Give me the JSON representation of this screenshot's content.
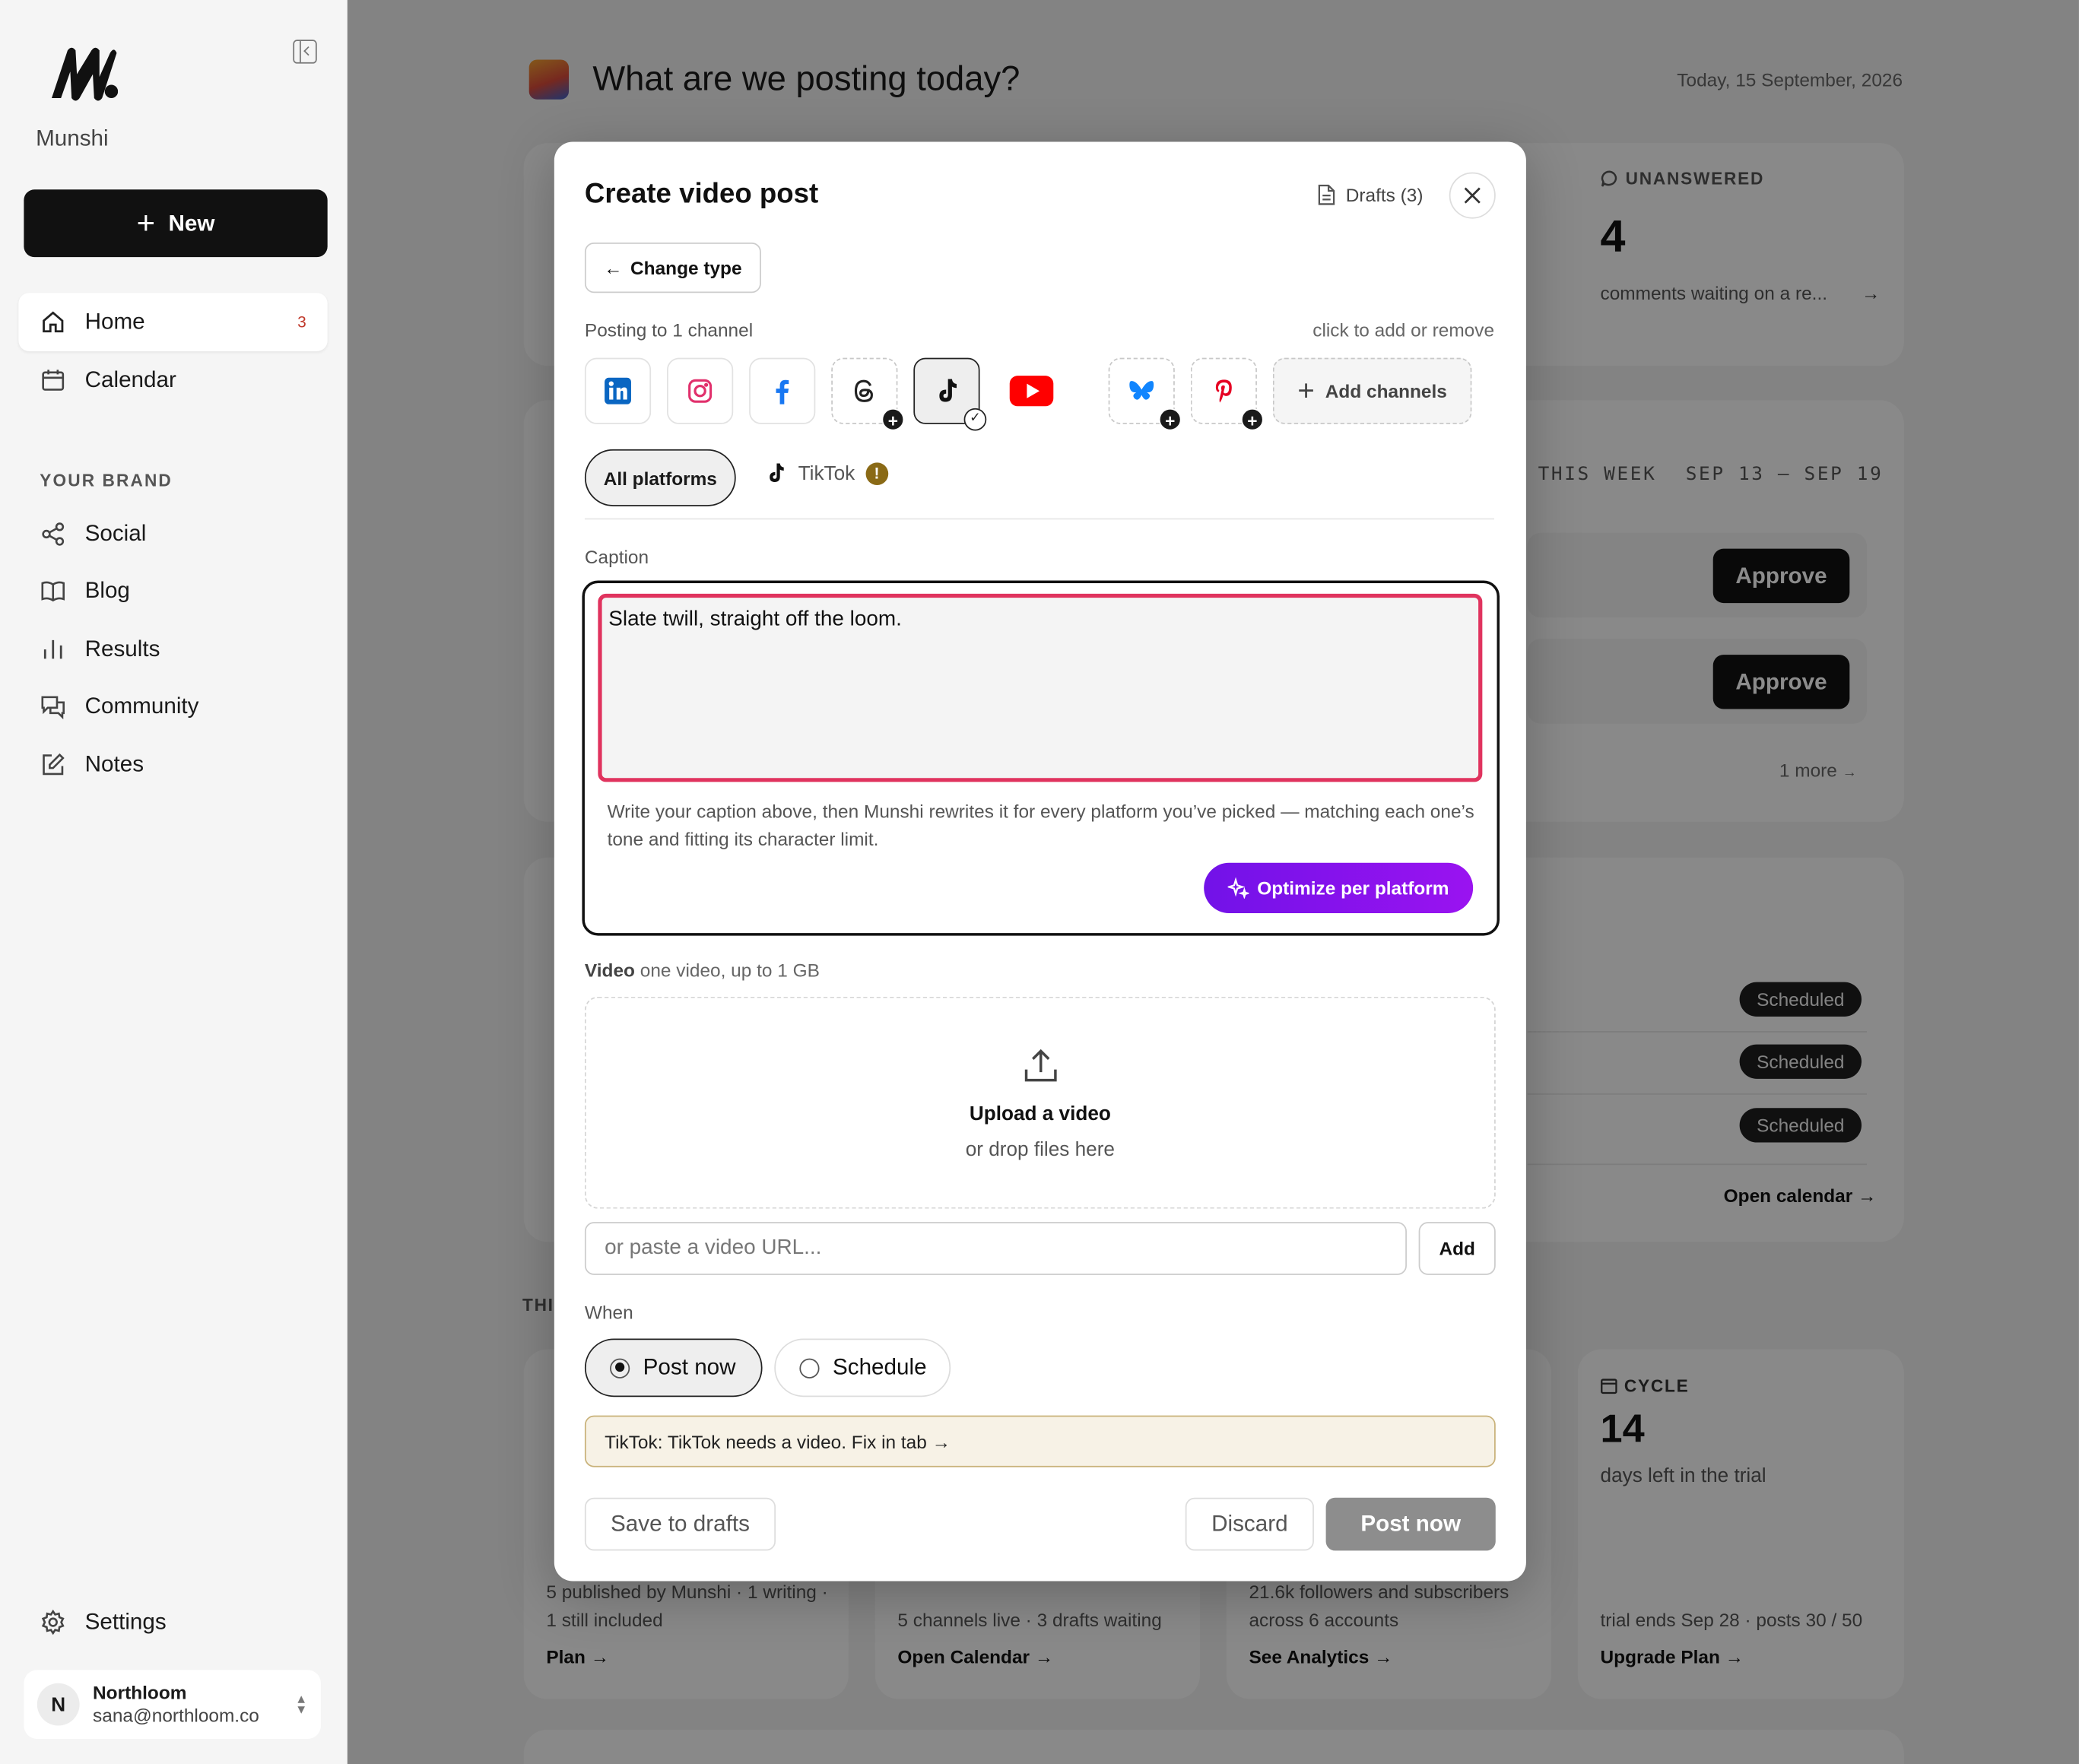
{
  "sidebar": {
    "brand_name": "Munshi",
    "new_label": "New",
    "nav": [
      {
        "label": "Home",
        "count": "3"
      },
      {
        "label": "Calendar"
      }
    ],
    "section_label": "YOUR BRAND",
    "brand_nav": [
      {
        "label": "Social"
      },
      {
        "label": "Blog"
      },
      {
        "label": "Results"
      },
      {
        "label": "Community"
      },
      {
        "label": "Notes"
      }
    ],
    "settings_label": "Settings",
    "account": {
      "initial": "N",
      "name": "Northloom",
      "email": "sana@northloom.co"
    }
  },
  "main": {
    "title": "What are we posting today?",
    "date": "Today, 15 September, 2026",
    "unanswered": {
      "label": "UNANSWERED",
      "count": "4",
      "text": "comments waiting on a re...",
      "arrow": "→"
    },
    "week": {
      "label": "THIS WEEK",
      "range": "SEP 13 – SEP 19",
      "approve_label": "Approve",
      "more": "1 more",
      "arrow": "→"
    },
    "scheduled": {
      "badge": "Scheduled",
      "link": "Open calendar →"
    },
    "section_partial": "THI",
    "stats": {
      "c1": {
        "text": "5 published by Munshi · 1 writing · 1 still included",
        "link": "Plan →"
      },
      "c2": {
        "text": "5 channels live · 3 drafts waiting",
        "link": "Open Calendar →"
      },
      "c3": {
        "text": "21.6k followers and subscribers across 6 accounts",
        "link": "See Analytics →"
      },
      "c4": {
        "label": "CYCLE",
        "big": "14",
        "sub": "days left in the trial",
        "text": "trial ends Sep 28 · posts 30 / 50",
        "link": "Upgrade Plan →"
      }
    }
  },
  "modal": {
    "title": "Create video post",
    "drafts_label": "Drafts (3)",
    "change_type_label": "Change type",
    "posting_label": "Posting to 1 channel",
    "posting_hint": "click to add or remove",
    "channels": [
      {
        "name": "LinkedIn",
        "icon": "linkedin-icon",
        "state": "available"
      },
      {
        "name": "Instagram",
        "icon": "instagram-icon",
        "state": "available"
      },
      {
        "name": "Facebook",
        "icon": "facebook-icon",
        "state": "available"
      },
      {
        "name": "Threads",
        "icon": "threads-icon",
        "state": "not-connected"
      },
      {
        "name": "TikTok",
        "icon": "tiktok-icon",
        "state": "selected"
      },
      {
        "name": "YouTube",
        "icon": "youtube-icon",
        "state": "available"
      },
      {
        "name": "Bluesky",
        "icon": "bluesky-icon",
        "state": "not-connected"
      },
      {
        "name": "Pinterest",
        "icon": "pinterest-icon",
        "state": "not-connected"
      }
    ],
    "add_channels_label": "Add channels",
    "tabs": {
      "all": "All platforms",
      "tiktok": "TikTok",
      "warning": "!"
    },
    "caption": {
      "label": "Caption",
      "value": "Slate twill, straight off the loom.",
      "help": "Write your caption above, then Munshi rewrites it for every platform you’ve picked — matching each one’s tone and fitting its character limit.",
      "optimize_label": "Optimize per platform"
    },
    "video": {
      "label": "Video",
      "hint": "one video, up to 1 GB",
      "upload_title": "Upload a video",
      "upload_sub": "or drop files here",
      "url_placeholder": "or paste a video URL...",
      "add_label": "Add"
    },
    "when": {
      "label": "When",
      "post_now": "Post now",
      "schedule": "Schedule",
      "selected": "post_now"
    },
    "alert": "TikTok: TikTok needs a video. Fix in tab →",
    "footer": {
      "save_drafts": "Save to drafts",
      "discard": "Discard",
      "post_now": "Post now"
    }
  },
  "colors": {
    "accent_optimize": "#7212e8",
    "caption_border": "#e0335e",
    "warning_badge": "#8a6a16",
    "alert_bg": "#f7f2e6",
    "primary_dark": "#111111"
  }
}
